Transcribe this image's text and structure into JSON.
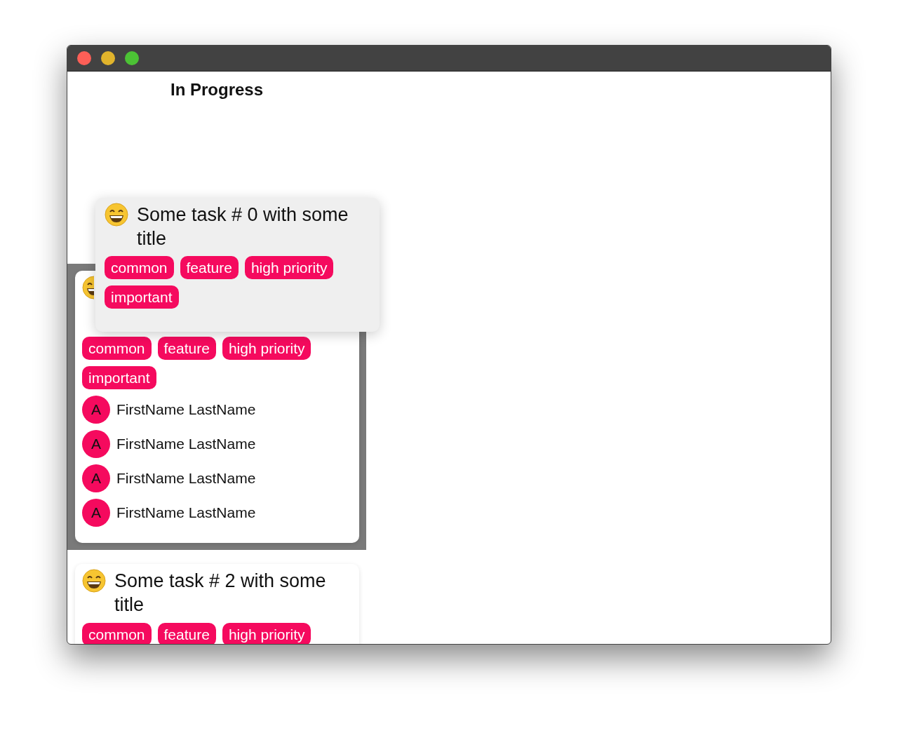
{
  "columns": [
    {
      "title": "In Progress",
      "drop_target": true,
      "dragged_card": {
        "title": "Some task # 0 with some title",
        "tags": [
          "common",
          "feature",
          "high priority",
          "important"
        ]
      },
      "cards": [
        {
          "tags": [
            "common",
            "feature",
            "high priority",
            "important"
          ],
          "assignees": [
            {
              "initial": "A",
              "name": "FirstName LastName"
            },
            {
              "initial": "A",
              "name": "FirstName LastName"
            },
            {
              "initial": "A",
              "name": "FirstName LastName"
            },
            {
              "initial": "A",
              "name": "FirstName LastName"
            }
          ]
        },
        {
          "title": "Some task # 2 with some title",
          "tags": [
            "common",
            "feature",
            "high priority"
          ]
        }
      ]
    }
  ]
}
